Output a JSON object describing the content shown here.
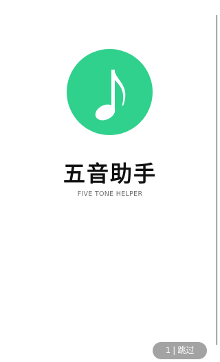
{
  "splash": {
    "logo_icon": "music-note-icon",
    "logo_color": "#2fd18d",
    "title": "五音助手",
    "subtitle": "FIVE TONE HELPER"
  },
  "skip": {
    "count": "1",
    "separator": "|",
    "label": "跳过",
    "background": "#a3a3a3"
  }
}
